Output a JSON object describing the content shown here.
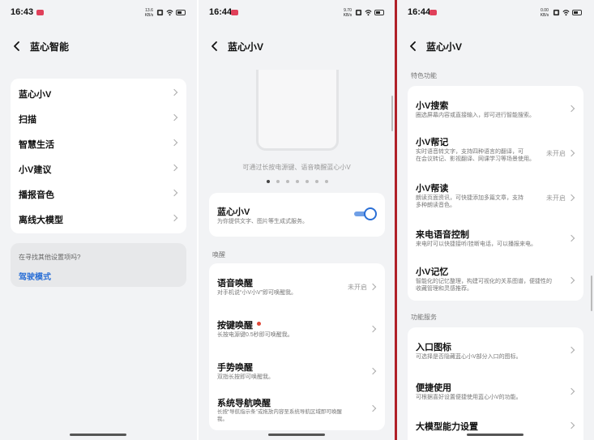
{
  "panel1": {
    "time": "16:43",
    "net_rate": "13.6\nKB/s",
    "title": "蓝心智能",
    "items": [
      "蓝心小V",
      "扫描",
      "智慧生活",
      "小V建议",
      "播报音色",
      "离线大模型"
    ],
    "search_hint": "在寻找其他设置项吗?",
    "search_link": "驾驶模式"
  },
  "panel2": {
    "time": "16:44",
    "net_rate": "9.70\nKB/s",
    "title": "蓝心小V",
    "preview_caption": "可通过长按电源键、语音唤醒蓝心小V",
    "toggle": {
      "title": "蓝心小V",
      "desc": "为你提供文字、图片等生成式服务。",
      "on": true
    },
    "section": "唤醒",
    "items": [
      {
        "title": "语音唤醒",
        "desc": "对手机说“小V小V”即可唤醒我。",
        "value": "未开启"
      },
      {
        "title": "按键唤醒",
        "desc": "长按电源键0.5秒即可唤醒我。",
        "value": ""
      },
      {
        "title": "手势唤醒",
        "desc": "双指长按即可唤醒我。",
        "value": ""
      },
      {
        "title": "系统导航唤醒",
        "desc": "长按“导航指示条”或拖放内容至系统导航区域即可唤醒",
        "desc2": "我。",
        "value": ""
      }
    ]
  },
  "panel3": {
    "time": "16:44",
    "net_rate": "0.00\nKB/s",
    "title": "蓝心小V",
    "section1": "特色功能",
    "features": [
      {
        "title": "小V搜索",
        "desc": "圈选屏幕内容或直接输入，即可进行智能搜索。",
        "desc2": "",
        "value": ""
      },
      {
        "title": "小V帮记",
        "desc": "实时语音转文字，支持四种语言的翻译，可",
        "desc2": "在会议转记、影视翻译、网课学习等场景使用。",
        "value": "未开启"
      },
      {
        "title": "小V帮读",
        "desc": "朗读页面资讯，可快捷添加多篇文章，支持",
        "desc2": "多种朗读音色。",
        "value": "未开启"
      },
      {
        "title": "来电语音控制",
        "desc": "来电时可以快捷接听/挂断电话，可以播报来电。",
        "desc2": "",
        "value": ""
      },
      {
        "title": "小V记忆",
        "desc": "智能化的记忆整理，构建可视化的关系图谱，便捷性的",
        "desc2": "收藏管理和灵感推荐。",
        "value": ""
      }
    ],
    "section2": "功能服务",
    "services": [
      {
        "title": "入口图标",
        "desc": "可选择是否隐藏蓝心小V部分入口的图标。"
      },
      {
        "title": "便捷使用",
        "desc": "可根据喜好设置便捷使用蓝心小V的功能。"
      },
      {
        "title": "大模型能力设置",
        "desc": ""
      }
    ]
  },
  "colors": {
    "accent": "#2a6fd6",
    "toggle_on": "#2a6fd6",
    "divider": "#b02028",
    "badge": "#e04a3a"
  }
}
